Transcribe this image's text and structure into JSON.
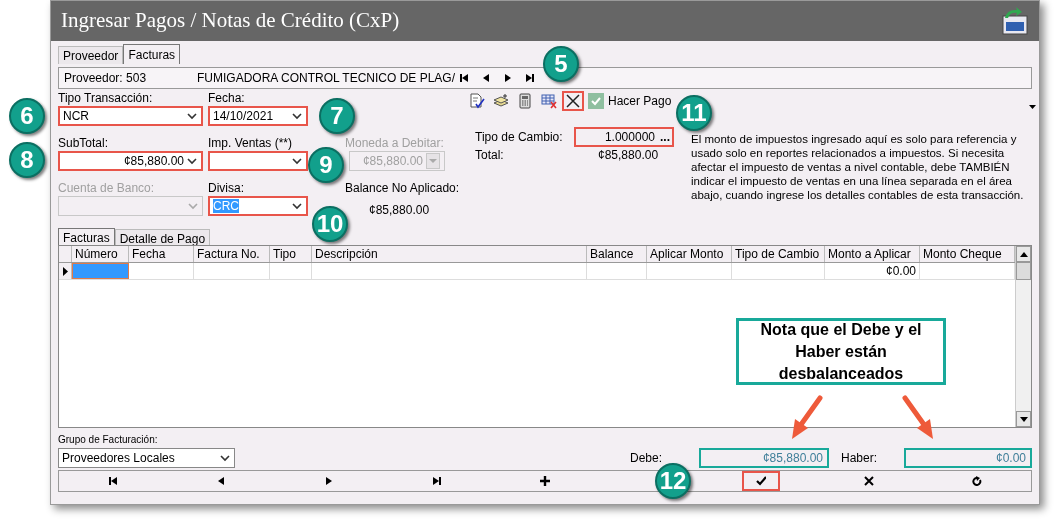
{
  "window": {
    "title": "Ingresar Pagos / Notas de Crédito (CxP)"
  },
  "tabs": [
    {
      "label": "Proveedor",
      "selected": false
    },
    {
      "label": "Facturas",
      "selected": true
    }
  ],
  "provider_bar": {
    "code": "Proveedor: 503",
    "name": "FUMIGADORA CONTROL TECNICO DE PLAG/"
  },
  "form_rows": [
    [
      {
        "kind": "select",
        "label": "Tipo Transacción:",
        "value": "NCR",
        "disabled": false,
        "highlighted": true
      },
      {
        "kind": "select",
        "label": "Fecha:",
        "value": "14/10/2021",
        "disabled": false,
        "highlighted": true
      }
    ],
    [
      {
        "kind": "select",
        "label": "SubTotal:",
        "value": "¢85,880.00",
        "right_aligned": true,
        "disabled": false,
        "highlighted": true
      },
      {
        "kind": "select",
        "label": "Imp. Ventas (**)",
        "disabled": false,
        "highlighted": true
      },
      {
        "kind": "select",
        "label": "Moneda a Debitar:",
        "value": "¢85,880.00",
        "right_aligned": true,
        "disabled": true,
        "highlighted": false
      }
    ],
    [
      {
        "kind": "select",
        "label": "Cuenta de Banco:",
        "disabled": true,
        "highlighted": false
      },
      {
        "kind": "select",
        "label": "Divisa:",
        "value": "CRC",
        "selected_text": true,
        "disabled": false,
        "highlighted": true
      },
      {
        "kind": "text",
        "label": "Balance No Aplicado:",
        "value": "¢85,880.00"
      }
    ]
  ],
  "tools": [
    {
      "kind": "check-doc",
      "highlighted": false
    },
    {
      "kind": "stack",
      "highlighted": false
    },
    {
      "kind": "calculator",
      "highlighted": false
    },
    {
      "kind": "grid-delete",
      "highlighted": false
    },
    {
      "kind": "cross",
      "highlighted": true
    }
  ],
  "hacer_pago": {
    "label": "Hacer Pago",
    "checked": true
  },
  "exchange": {
    "label": "Tipo de Cambio:",
    "value": "1.000000",
    "button": "...",
    "highlighted": true
  },
  "total": {
    "label": "Total:",
    "value": "¢85,880.00"
  },
  "note_text": "El monto de impuestos ingresado aquí es solo para referencia y usado solo en reportes relacionados a impuestos. Si necesita afectar el impuesto de ventas a nivel contable, debe TAMBIÉN indicar el impuesto de ventas en una línea separada en el área abajo, cuando ingrese los detalles contables de esta transacción.",
  "grid_tabs": [
    {
      "label": "Facturas",
      "selected": true
    },
    {
      "label": "Detalle de Pago",
      "selected": false
    }
  ],
  "grid": {
    "columns": [
      "Número",
      "Fecha",
      "Factura No.",
      "Tipo",
      "Descripción",
      "Balance",
      "Aplicar Monto",
      "Tipo de Cambio",
      "Monto a Aplicar",
      "Monto Cheque"
    ],
    "rows": [
      {
        "current": true,
        "numero_selected": true,
        "monto_a_aplicar": "¢0.00"
      }
    ]
  },
  "billing_group": {
    "label": "Grupo de Facturación:",
    "value": "Proveedores Locales"
  },
  "totals": [
    {
      "label": "Debe:",
      "value": "¢85,880.00",
      "highlighted": true
    },
    {
      "label": "Haber:",
      "value": "¢0.00",
      "highlighted": true
    }
  ],
  "nav_buttons": [
    {
      "kind": "first",
      "highlighted": false
    },
    {
      "kind": "prev",
      "highlighted": false
    },
    {
      "kind": "next",
      "highlighted": false
    },
    {
      "kind": "last",
      "highlighted": false
    },
    {
      "kind": "add",
      "highlighted": false
    },
    {
      "kind": "ok",
      "highlighted": true
    },
    {
      "kind": "cancel",
      "highlighted": false
    },
    {
      "kind": "refresh",
      "highlighted": false
    }
  ],
  "callouts": [
    {
      "number": "5"
    },
    {
      "number": "6"
    },
    {
      "number": "7"
    },
    {
      "number": "8"
    },
    {
      "number": "9"
    },
    {
      "number": "10"
    },
    {
      "number": "11"
    },
    {
      "number": "12"
    }
  ],
  "note": {
    "text": "Nota que el Debe y el Haber están desbalanceados"
  }
}
